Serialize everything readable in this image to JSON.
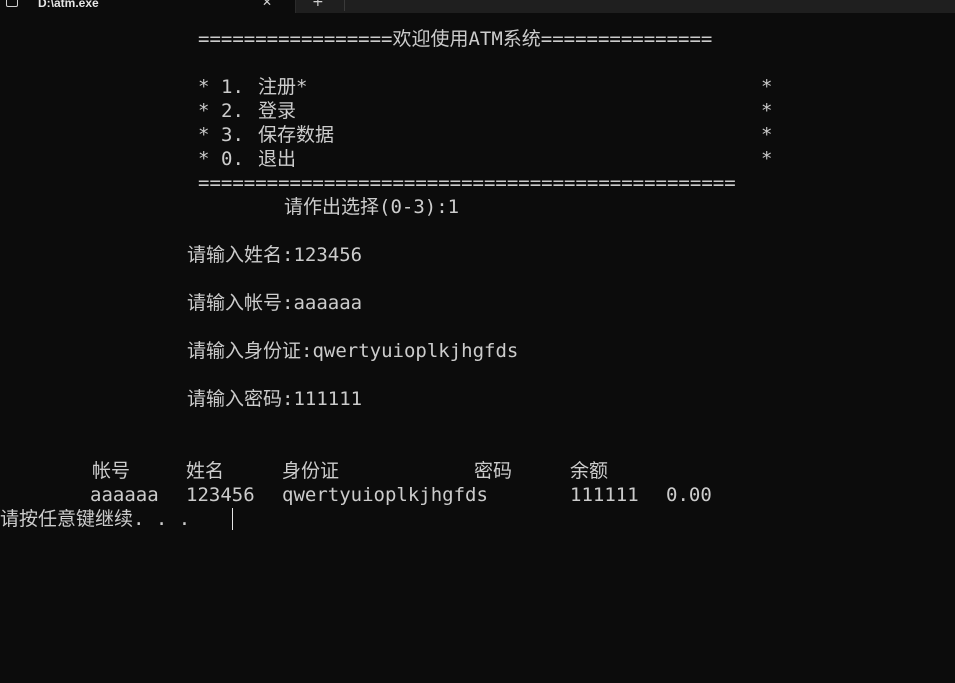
{
  "tab": {
    "title": "D:\\atm.exe",
    "close_glyph": "✕",
    "new_tab_glyph": "+"
  },
  "menu": {
    "header": "=================欢迎使用ATM系统===============",
    "items": [
      {
        "num": "1.",
        "label": "注册*",
        "tail": "*"
      },
      {
        "num": "2.",
        "label": "登录",
        "tail": "*"
      },
      {
        "num": "3.",
        "label": "保存数据",
        "tail": "*"
      },
      {
        "num": "0.",
        "label": "退出",
        "tail": "*"
      }
    ],
    "footer": "==============================================="
  },
  "prompt": {
    "choice": "请作出选择(0-3):1"
  },
  "inputs": [
    {
      "label": "请输入姓名:",
      "value": "123456"
    },
    {
      "label": "请输入帐号:",
      "value": "aaaaaa"
    },
    {
      "label": "请输入身份证:",
      "value": "qwertyuioplkjhgfds"
    },
    {
      "label": "请输入密码:",
      "value": "111111"
    }
  ],
  "table": {
    "headers": [
      "帐号",
      "姓名",
      "身份证",
      "密码",
      "余额"
    ],
    "row": [
      "aaaaaa",
      "123456",
      "qwertyuioplkjhgfds",
      "111111",
      "0.00"
    ]
  },
  "continue_prompt": "请按任意键继续. . ."
}
